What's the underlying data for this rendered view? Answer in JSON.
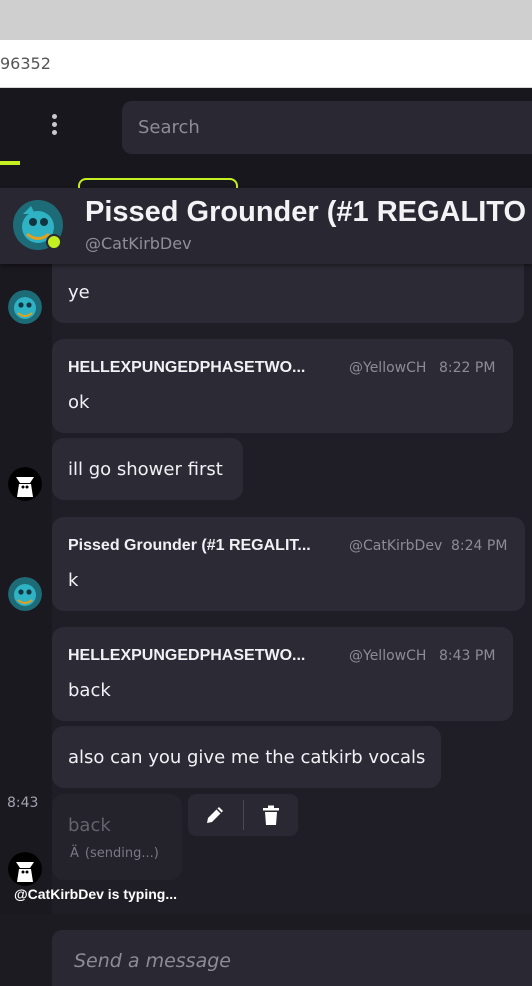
{
  "browser": {
    "url_fragment": "96352"
  },
  "topbar": {
    "search_placeholder": "Search"
  },
  "chat_header": {
    "title": "Pissed Grounder (#1 REGALITO",
    "handle": "@CatKirbDev",
    "status": "online"
  },
  "messages": [
    {
      "text": "ye"
    },
    {
      "username": "HELLEXPUNGEDPHASETWO...",
      "handle": "@YellowCH",
      "time": "8:22 PM",
      "text": "ok"
    },
    {
      "text": "ill go shower first"
    },
    {
      "username": "Pissed Grounder (#1 REGALIT...",
      "handle": "@CatKirbDev",
      "time": "8:24 PM",
      "text": "k"
    },
    {
      "username": "HELLEXPUNGEDPHASETWO...",
      "handle": "@YellowCH",
      "time": "8:43 PM",
      "text": "back"
    },
    {
      "text": "also can you give me the catkirb vocals"
    }
  ],
  "pending": {
    "side_time": "8:43",
    "text": "back",
    "status": "(sending...)"
  },
  "message_actions": {
    "edit_icon": "pencil-icon",
    "delete_icon": "trash-icon"
  },
  "typing_indicator": "@CatKirbDev is typing...",
  "composer": {
    "placeholder": "Send a message"
  },
  "colors": {
    "accent": "#c4f021",
    "bubble": "#2c2b35",
    "background": "#1f1e26"
  }
}
